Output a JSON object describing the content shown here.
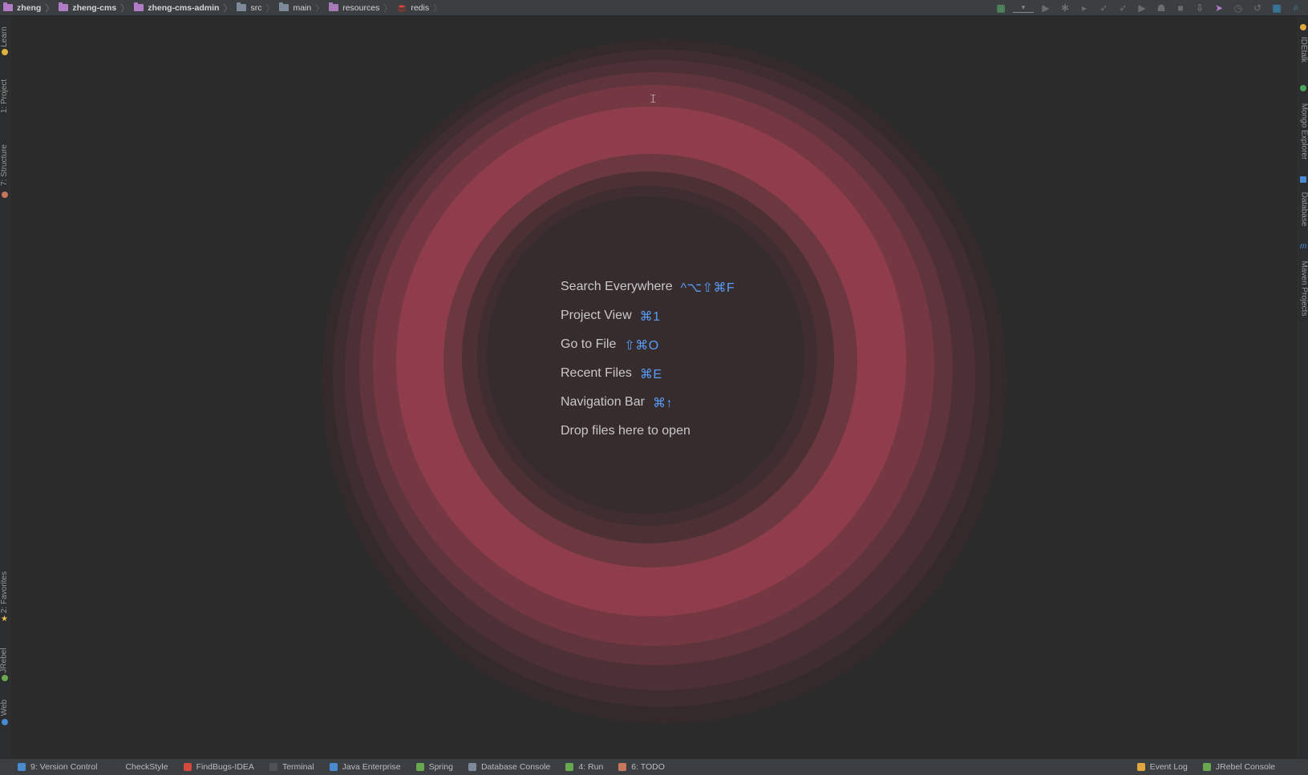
{
  "breadcrumbs": [
    {
      "label": "zheng",
      "kind": "module",
      "bold": true
    },
    {
      "label": "zheng-cms",
      "kind": "module",
      "bold": true
    },
    {
      "label": "zheng-cms-admin",
      "kind": "module",
      "bold": true
    },
    {
      "label": "src",
      "kind": "plain",
      "bold": false
    },
    {
      "label": "main",
      "kind": "plain",
      "bold": false
    },
    {
      "label": "resources",
      "kind": "res",
      "bold": false
    },
    {
      "label": "redis",
      "kind": "redis",
      "bold": false
    }
  ],
  "left_tool_tabs": [
    {
      "label": "Learn",
      "icon": "learn-icon"
    },
    {
      "label": "1: Project",
      "icon": "project-icon"
    },
    {
      "label": "7: Structure",
      "icon": "structure-icon"
    },
    {
      "label": "2: Favorites",
      "icon": "star-icon"
    },
    {
      "label": "JRebel",
      "icon": "jrebel-icon"
    },
    {
      "label": "Web",
      "icon": "web-icon"
    }
  ],
  "right_tool_tabs": [
    {
      "label": "IDEtalk",
      "icon": "idetalk-icon"
    },
    {
      "label": "Mongo Explorer",
      "icon": "mongo-icon"
    },
    {
      "label": "Database",
      "icon": "database-icon"
    },
    {
      "label": "Maven Projects",
      "icon": "maven-icon"
    }
  ],
  "bottom_tabs": [
    {
      "label": "9: Version Control",
      "icon": "version-control-icon"
    },
    {
      "label": "CheckStyle",
      "icon": "checkstyle-icon"
    },
    {
      "label": "FindBugs-IDEA",
      "icon": "findbugs-icon"
    },
    {
      "label": "Terminal",
      "icon": "terminal-icon"
    },
    {
      "label": "Java Enterprise",
      "icon": "java-enterprise-icon"
    },
    {
      "label": "Spring",
      "icon": "spring-icon"
    },
    {
      "label": "Database Console",
      "icon": "database-console-icon"
    },
    {
      "label": "4: Run",
      "icon": "run-icon"
    },
    {
      "label": "6: TODO",
      "icon": "todo-icon"
    }
  ],
  "bottom_right_tabs": [
    {
      "label": "Event Log",
      "icon": "event-log-icon"
    },
    {
      "label": "JRebel Console",
      "icon": "jrebel-console-icon"
    }
  ],
  "hints": [
    {
      "label": "Search Everywhere",
      "shortcut": "^⌥⇧⌘F"
    },
    {
      "label": "Project View",
      "shortcut": "⌘1"
    },
    {
      "label": "Go to File",
      "shortcut": "⇧⌘O"
    },
    {
      "label": "Recent Files",
      "shortcut": "⌘E"
    },
    {
      "label": "Navigation Bar",
      "shortcut": "⌘↑"
    },
    {
      "label": "Drop files here to open",
      "shortcut": ""
    }
  ],
  "colors": {
    "background": "#2b2b2b",
    "ring_accent": "#973f4e",
    "shortcut": "#589df6"
  }
}
